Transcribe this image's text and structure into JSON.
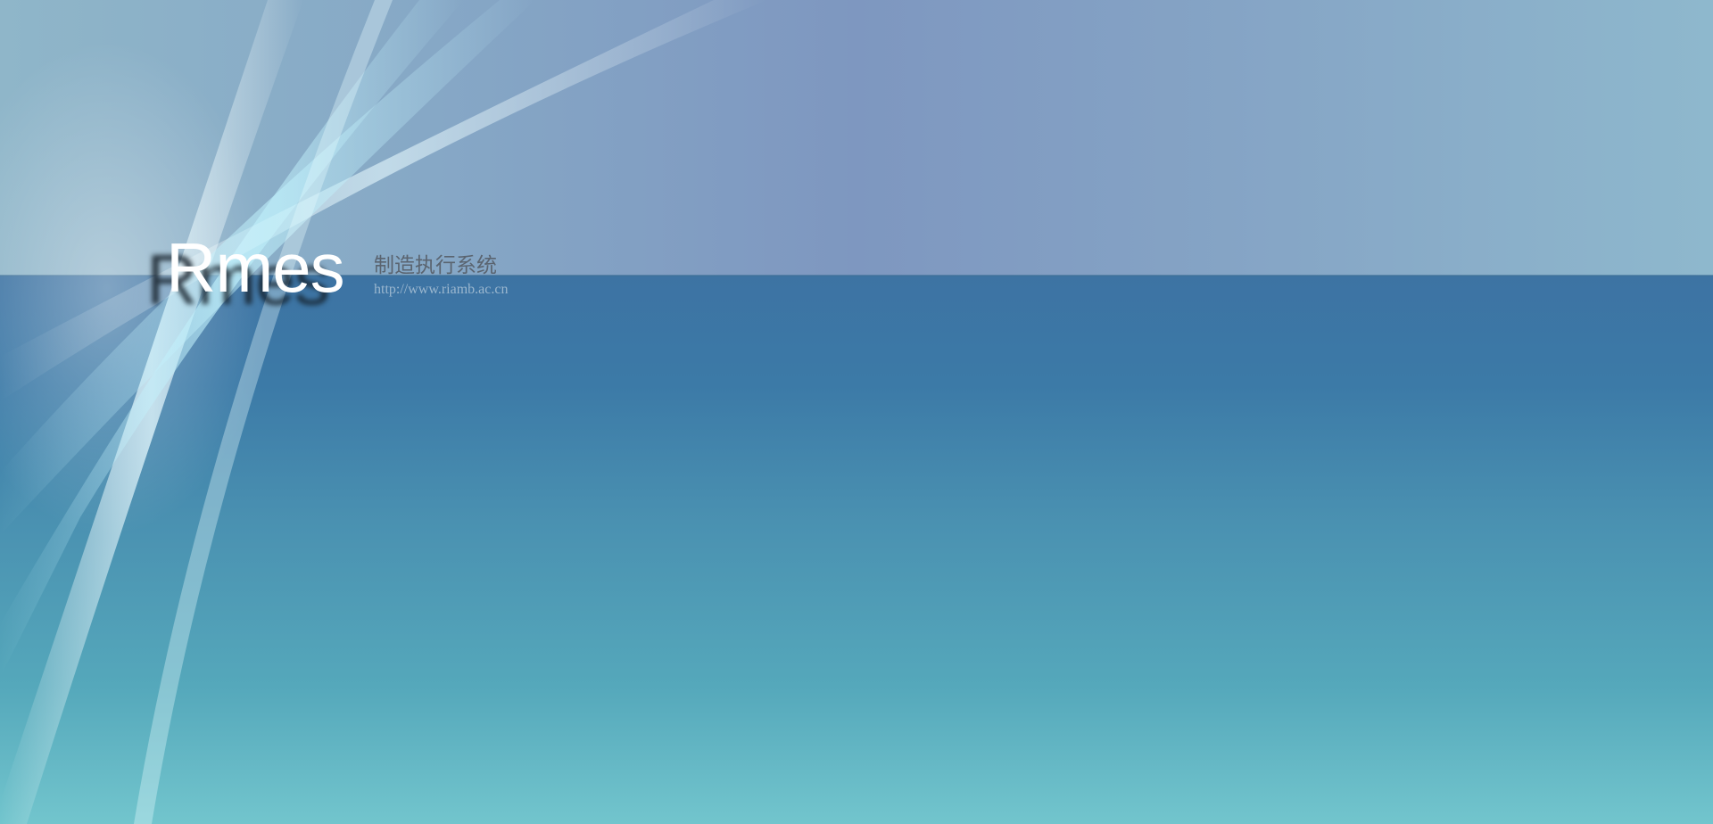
{
  "app": {
    "logo": "Rmes",
    "subtitle": "制造执行系统",
    "url": "http://www.riamb.ac.cn"
  },
  "colors": {
    "sky": "#86a6c6",
    "sea_top": "#3d73a3",
    "sea_bottom": "#72c5cd",
    "logo_text": "#ffffff",
    "subtitle_text": "#5a6470",
    "url_text": "#9bb7cf"
  }
}
